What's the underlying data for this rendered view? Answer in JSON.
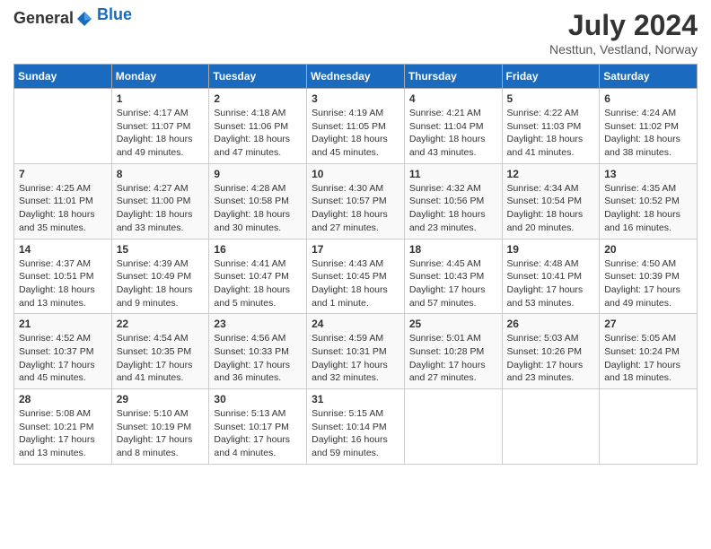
{
  "header": {
    "logo_general": "General",
    "logo_blue": "Blue",
    "month_title": "July 2024",
    "location": "Nesttun, Vestland, Norway"
  },
  "days_of_week": [
    "Sunday",
    "Monday",
    "Tuesday",
    "Wednesday",
    "Thursday",
    "Friday",
    "Saturday"
  ],
  "weeks": [
    [
      {
        "day": "",
        "sunrise": "",
        "sunset": "",
        "daylight": ""
      },
      {
        "day": "1",
        "sunrise": "Sunrise: 4:17 AM",
        "sunset": "Sunset: 11:07 PM",
        "daylight": "Daylight: 18 hours and 49 minutes."
      },
      {
        "day": "2",
        "sunrise": "Sunrise: 4:18 AM",
        "sunset": "Sunset: 11:06 PM",
        "daylight": "Daylight: 18 hours and 47 minutes."
      },
      {
        "day": "3",
        "sunrise": "Sunrise: 4:19 AM",
        "sunset": "Sunset: 11:05 PM",
        "daylight": "Daylight: 18 hours and 45 minutes."
      },
      {
        "day": "4",
        "sunrise": "Sunrise: 4:21 AM",
        "sunset": "Sunset: 11:04 PM",
        "daylight": "Daylight: 18 hours and 43 minutes."
      },
      {
        "day": "5",
        "sunrise": "Sunrise: 4:22 AM",
        "sunset": "Sunset: 11:03 PM",
        "daylight": "Daylight: 18 hours and 41 minutes."
      },
      {
        "day": "6",
        "sunrise": "Sunrise: 4:24 AM",
        "sunset": "Sunset: 11:02 PM",
        "daylight": "Daylight: 18 hours and 38 minutes."
      }
    ],
    [
      {
        "day": "7",
        "sunrise": "Sunrise: 4:25 AM",
        "sunset": "Sunset: 11:01 PM",
        "daylight": "Daylight: 18 hours and 35 minutes."
      },
      {
        "day": "8",
        "sunrise": "Sunrise: 4:27 AM",
        "sunset": "Sunset: 11:00 PM",
        "daylight": "Daylight: 18 hours and 33 minutes."
      },
      {
        "day": "9",
        "sunrise": "Sunrise: 4:28 AM",
        "sunset": "Sunset: 10:58 PM",
        "daylight": "Daylight: 18 hours and 30 minutes."
      },
      {
        "day": "10",
        "sunrise": "Sunrise: 4:30 AM",
        "sunset": "Sunset: 10:57 PM",
        "daylight": "Daylight: 18 hours and 27 minutes."
      },
      {
        "day": "11",
        "sunrise": "Sunrise: 4:32 AM",
        "sunset": "Sunset: 10:56 PM",
        "daylight": "Daylight: 18 hours and 23 minutes."
      },
      {
        "day": "12",
        "sunrise": "Sunrise: 4:34 AM",
        "sunset": "Sunset: 10:54 PM",
        "daylight": "Daylight: 18 hours and 20 minutes."
      },
      {
        "day": "13",
        "sunrise": "Sunrise: 4:35 AM",
        "sunset": "Sunset: 10:52 PM",
        "daylight": "Daylight: 18 hours and 16 minutes."
      }
    ],
    [
      {
        "day": "14",
        "sunrise": "Sunrise: 4:37 AM",
        "sunset": "Sunset: 10:51 PM",
        "daylight": "Daylight: 18 hours and 13 minutes."
      },
      {
        "day": "15",
        "sunrise": "Sunrise: 4:39 AM",
        "sunset": "Sunset: 10:49 PM",
        "daylight": "Daylight: 18 hours and 9 minutes."
      },
      {
        "day": "16",
        "sunrise": "Sunrise: 4:41 AM",
        "sunset": "Sunset: 10:47 PM",
        "daylight": "Daylight: 18 hours and 5 minutes."
      },
      {
        "day": "17",
        "sunrise": "Sunrise: 4:43 AM",
        "sunset": "Sunset: 10:45 PM",
        "daylight": "Daylight: 18 hours and 1 minute."
      },
      {
        "day": "18",
        "sunrise": "Sunrise: 4:45 AM",
        "sunset": "Sunset: 10:43 PM",
        "daylight": "Daylight: 17 hours and 57 minutes."
      },
      {
        "day": "19",
        "sunrise": "Sunrise: 4:48 AM",
        "sunset": "Sunset: 10:41 PM",
        "daylight": "Daylight: 17 hours and 53 minutes."
      },
      {
        "day": "20",
        "sunrise": "Sunrise: 4:50 AM",
        "sunset": "Sunset: 10:39 PM",
        "daylight": "Daylight: 17 hours and 49 minutes."
      }
    ],
    [
      {
        "day": "21",
        "sunrise": "Sunrise: 4:52 AM",
        "sunset": "Sunset: 10:37 PM",
        "daylight": "Daylight: 17 hours and 45 minutes."
      },
      {
        "day": "22",
        "sunrise": "Sunrise: 4:54 AM",
        "sunset": "Sunset: 10:35 PM",
        "daylight": "Daylight: 17 hours and 41 minutes."
      },
      {
        "day": "23",
        "sunrise": "Sunrise: 4:56 AM",
        "sunset": "Sunset: 10:33 PM",
        "daylight": "Daylight: 17 hours and 36 minutes."
      },
      {
        "day": "24",
        "sunrise": "Sunrise: 4:59 AM",
        "sunset": "Sunset: 10:31 PM",
        "daylight": "Daylight: 17 hours and 32 minutes."
      },
      {
        "day": "25",
        "sunrise": "Sunrise: 5:01 AM",
        "sunset": "Sunset: 10:28 PM",
        "daylight": "Daylight: 17 hours and 27 minutes."
      },
      {
        "day": "26",
        "sunrise": "Sunrise: 5:03 AM",
        "sunset": "Sunset: 10:26 PM",
        "daylight": "Daylight: 17 hours and 23 minutes."
      },
      {
        "day": "27",
        "sunrise": "Sunrise: 5:05 AM",
        "sunset": "Sunset: 10:24 PM",
        "daylight": "Daylight: 17 hours and 18 minutes."
      }
    ],
    [
      {
        "day": "28",
        "sunrise": "Sunrise: 5:08 AM",
        "sunset": "Sunset: 10:21 PM",
        "daylight": "Daylight: 17 hours and 13 minutes."
      },
      {
        "day": "29",
        "sunrise": "Sunrise: 5:10 AM",
        "sunset": "Sunset: 10:19 PM",
        "daylight": "Daylight: 17 hours and 8 minutes."
      },
      {
        "day": "30",
        "sunrise": "Sunrise: 5:13 AM",
        "sunset": "Sunset: 10:17 PM",
        "daylight": "Daylight: 17 hours and 4 minutes."
      },
      {
        "day": "31",
        "sunrise": "Sunrise: 5:15 AM",
        "sunset": "Sunset: 10:14 PM",
        "daylight": "Daylight: 16 hours and 59 minutes."
      },
      {
        "day": "",
        "sunrise": "",
        "sunset": "",
        "daylight": ""
      },
      {
        "day": "",
        "sunrise": "",
        "sunset": "",
        "daylight": ""
      },
      {
        "day": "",
        "sunrise": "",
        "sunset": "",
        "daylight": ""
      }
    ]
  ]
}
